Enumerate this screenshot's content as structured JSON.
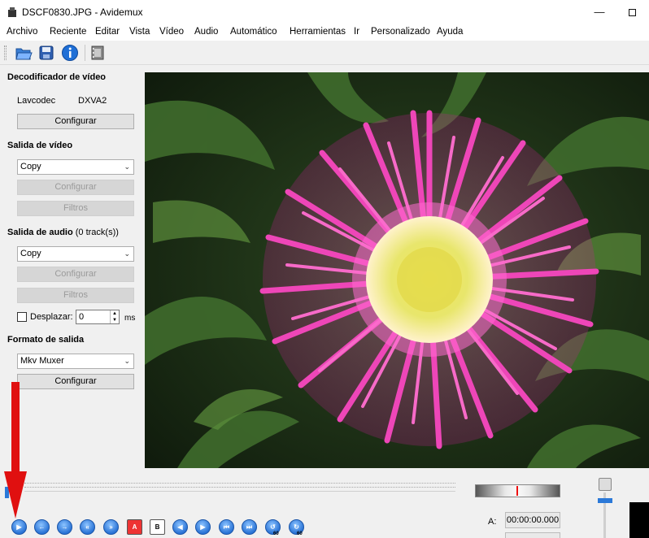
{
  "window": {
    "title": "DSCF0830.JPG - Avidemux",
    "minimize": "—"
  },
  "menu": [
    "Archivo",
    "Reciente",
    "Editar",
    "Vista",
    "Vídeo",
    "Audio",
    "Automático",
    "Herramientas",
    "Ir",
    "Personalizado",
    "Ayuda"
  ],
  "toolbar": {
    "icons": [
      "open-folder-icon",
      "save-disk-icon",
      "info-icon",
      "film-properties-icon"
    ]
  },
  "video_decoder": {
    "title": "Decodificador de vídeo",
    "codec_label": "Lavcodec",
    "codec_value": "DXVA2",
    "configure": "Configurar"
  },
  "video_output": {
    "title": "Salida de vídeo",
    "selected": "Copy",
    "configure": "Configurar",
    "filters": "Filtros"
  },
  "audio_output": {
    "title": "Salida de audio",
    "tracks": "(0 track(s))",
    "selected": "Copy",
    "configure": "Configurar",
    "filters": "Filtros",
    "shift_label": "Desplazar:",
    "shift_value": "0",
    "shift_unit": "ms"
  },
  "output_format": {
    "title": "Formato de salida",
    "selected": "Mkv Muxer",
    "configure": "Configurar"
  },
  "playback": {
    "time_label": "A:",
    "time_value": "00:00:00.000",
    "slider_position": 0,
    "controls": [
      "play-icon",
      "previous-frame-icon",
      "next-frame-icon",
      "previous-keyframe-icon",
      "next-keyframe-icon",
      "set-marker-a-icon",
      "set-marker-b-icon",
      "go-to-marker-a-icon",
      "go-to-marker-b-icon",
      "previous-black-frame-icon",
      "next-black-frame-icon",
      "go-back-60-icon",
      "go-forward-60-icon"
    ],
    "marker_a": "A",
    "marker_b": "B",
    "step_60": "60"
  },
  "colors": {
    "accent": "#2b79d8",
    "annotation_arrow": "#e01010",
    "flower": "#e83fb4"
  }
}
